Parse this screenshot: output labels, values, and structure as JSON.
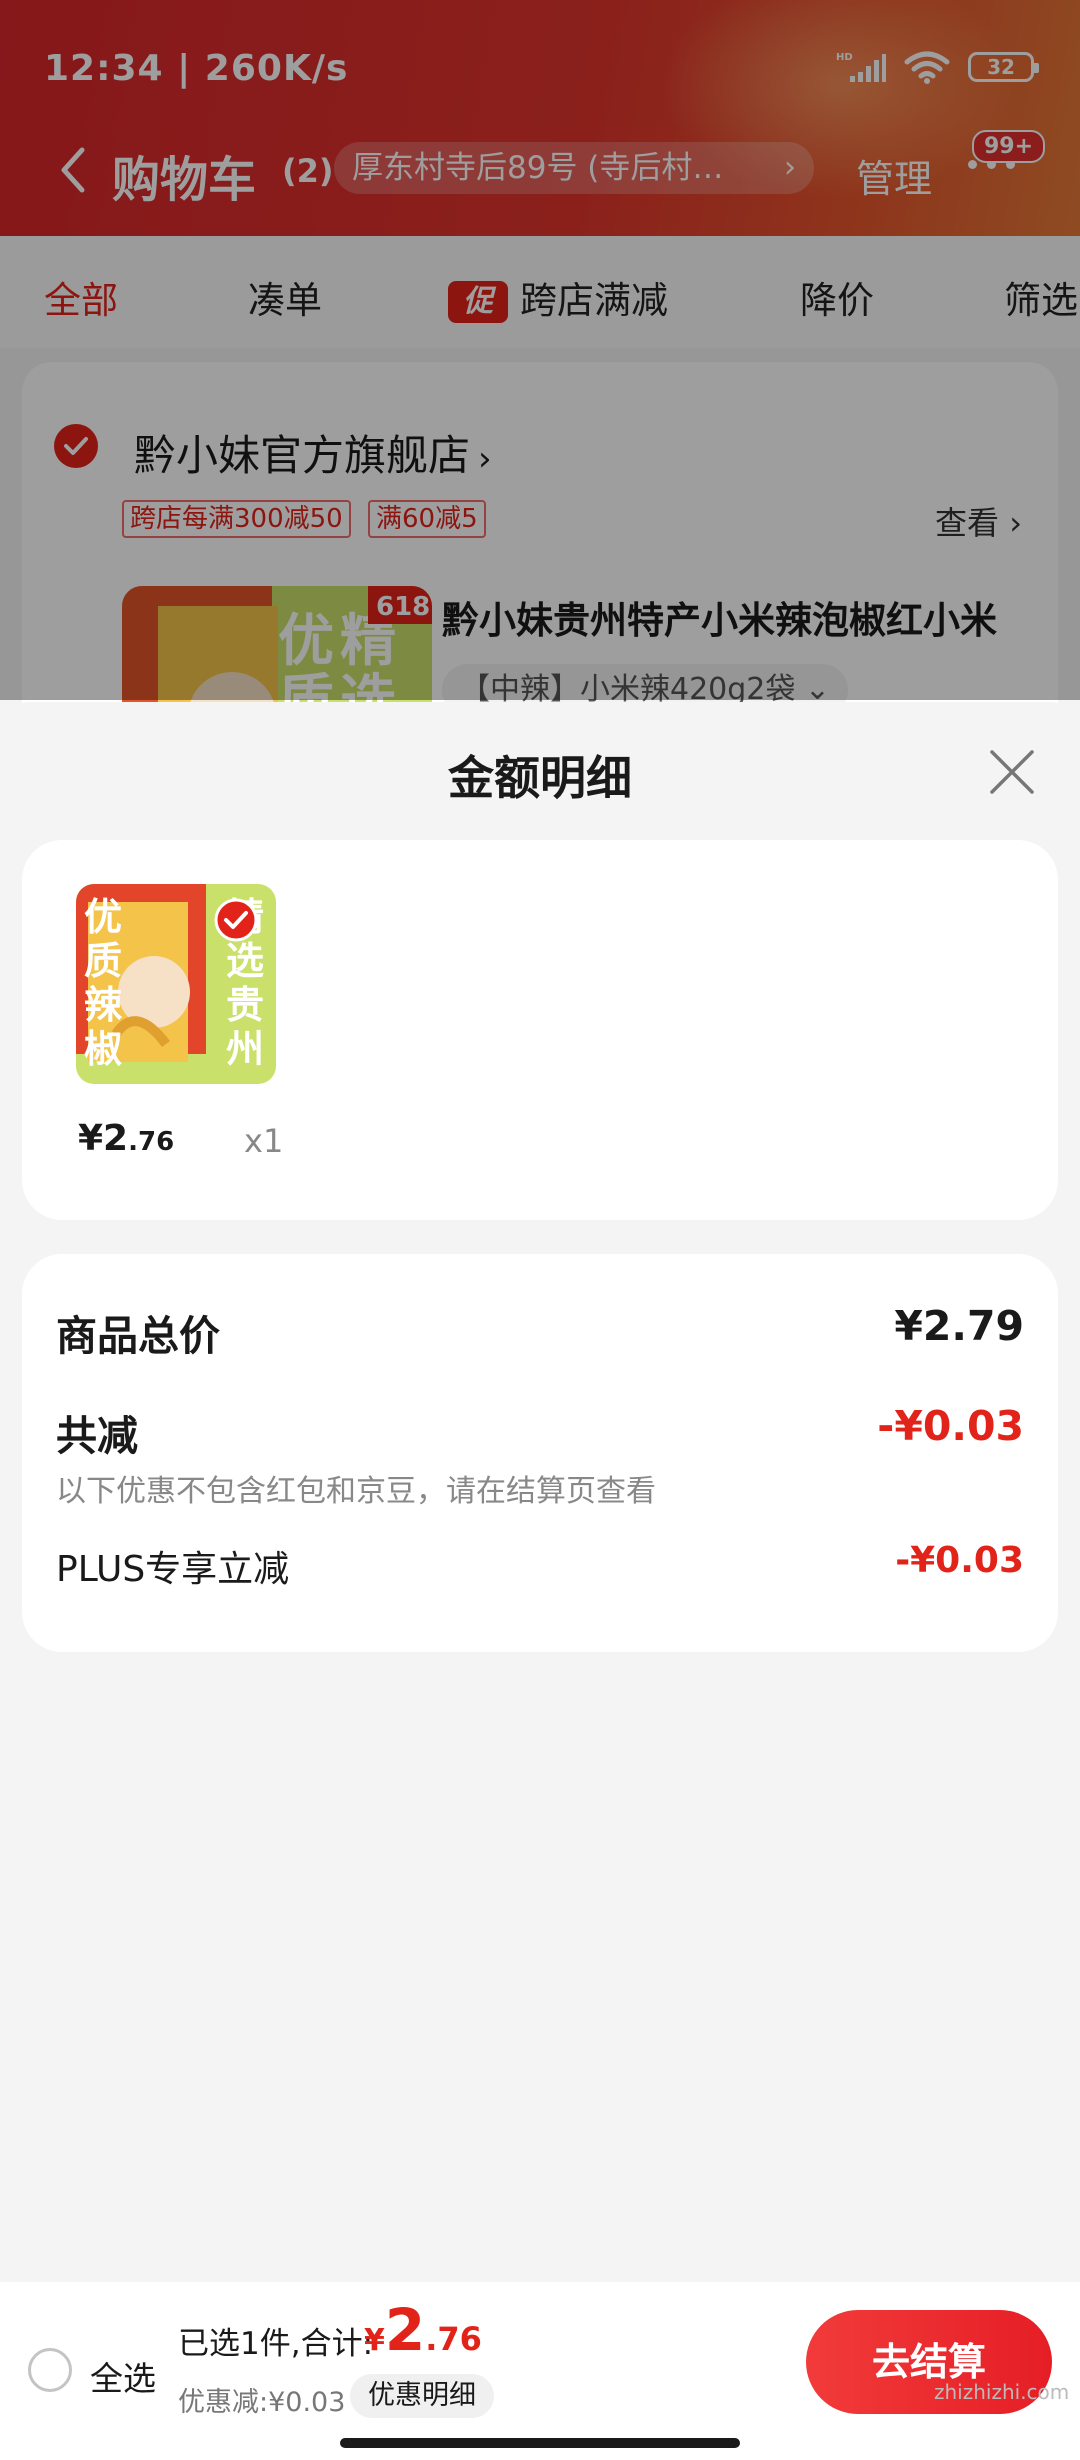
{
  "status_bar": {
    "time": "12:34 | 260K/s",
    "battery": "32",
    "network": "HD"
  },
  "nav": {
    "title": "购物车",
    "count": "(2)",
    "address": "厚东村寺后89号 (寺后村…",
    "address_chevron": "›",
    "manage": "管理",
    "badge": "99+"
  },
  "tabs": [
    {
      "label": "全部"
    },
    {
      "label": "凑单"
    },
    {
      "label": "跨店满减",
      "tag": "促"
    },
    {
      "label": "降价"
    },
    {
      "label": "筛选"
    }
  ],
  "store": {
    "name": "黔小妹官方旗舰店",
    "name_arrow": "›",
    "coupons": [
      "跨店每满300减50",
      "满60减5"
    ],
    "view_more": "查看 ›",
    "product": {
      "badge": "618",
      "title": "黔小妹贵州特产小米辣泡椒红小米",
      "spec": "【中辣】小米辣420g2袋 ⌄",
      "thumb_text": [
        "优",
        "质",
        "精",
        "选"
      ]
    }
  },
  "sheet": {
    "title": "金额明细",
    "item": {
      "image_text": [
        "优",
        "质",
        "辣",
        "椒",
        "精",
        "选",
        "贵",
        "州"
      ],
      "price_int": "¥2",
      "price_dec": ".76",
      "qty": "x1"
    },
    "summary": {
      "total_label": "商品总价",
      "total_value": "¥2.79",
      "discount_label": "共减",
      "discount_value": "-¥0.03",
      "note": "以下优惠不包含红包和京豆，请在结算页查看",
      "plus_label": "PLUS专享立减",
      "plus_value": "-¥0.03"
    }
  },
  "bottom_bar": {
    "select_all": "全选",
    "selected_text": "已选1件,合计:",
    "total_cur": "¥",
    "total_int": "2",
    "total_dec": ".76",
    "discount_text": "优惠减:¥0.03",
    "detail_chip": "优惠明细",
    "checkout": "去结算"
  },
  "watermark": "zhizhizhi.com",
  "colors": {
    "accent": "#e2231a",
    "header": "#d8262b",
    "sheet_bg": "#f4f4f4"
  }
}
